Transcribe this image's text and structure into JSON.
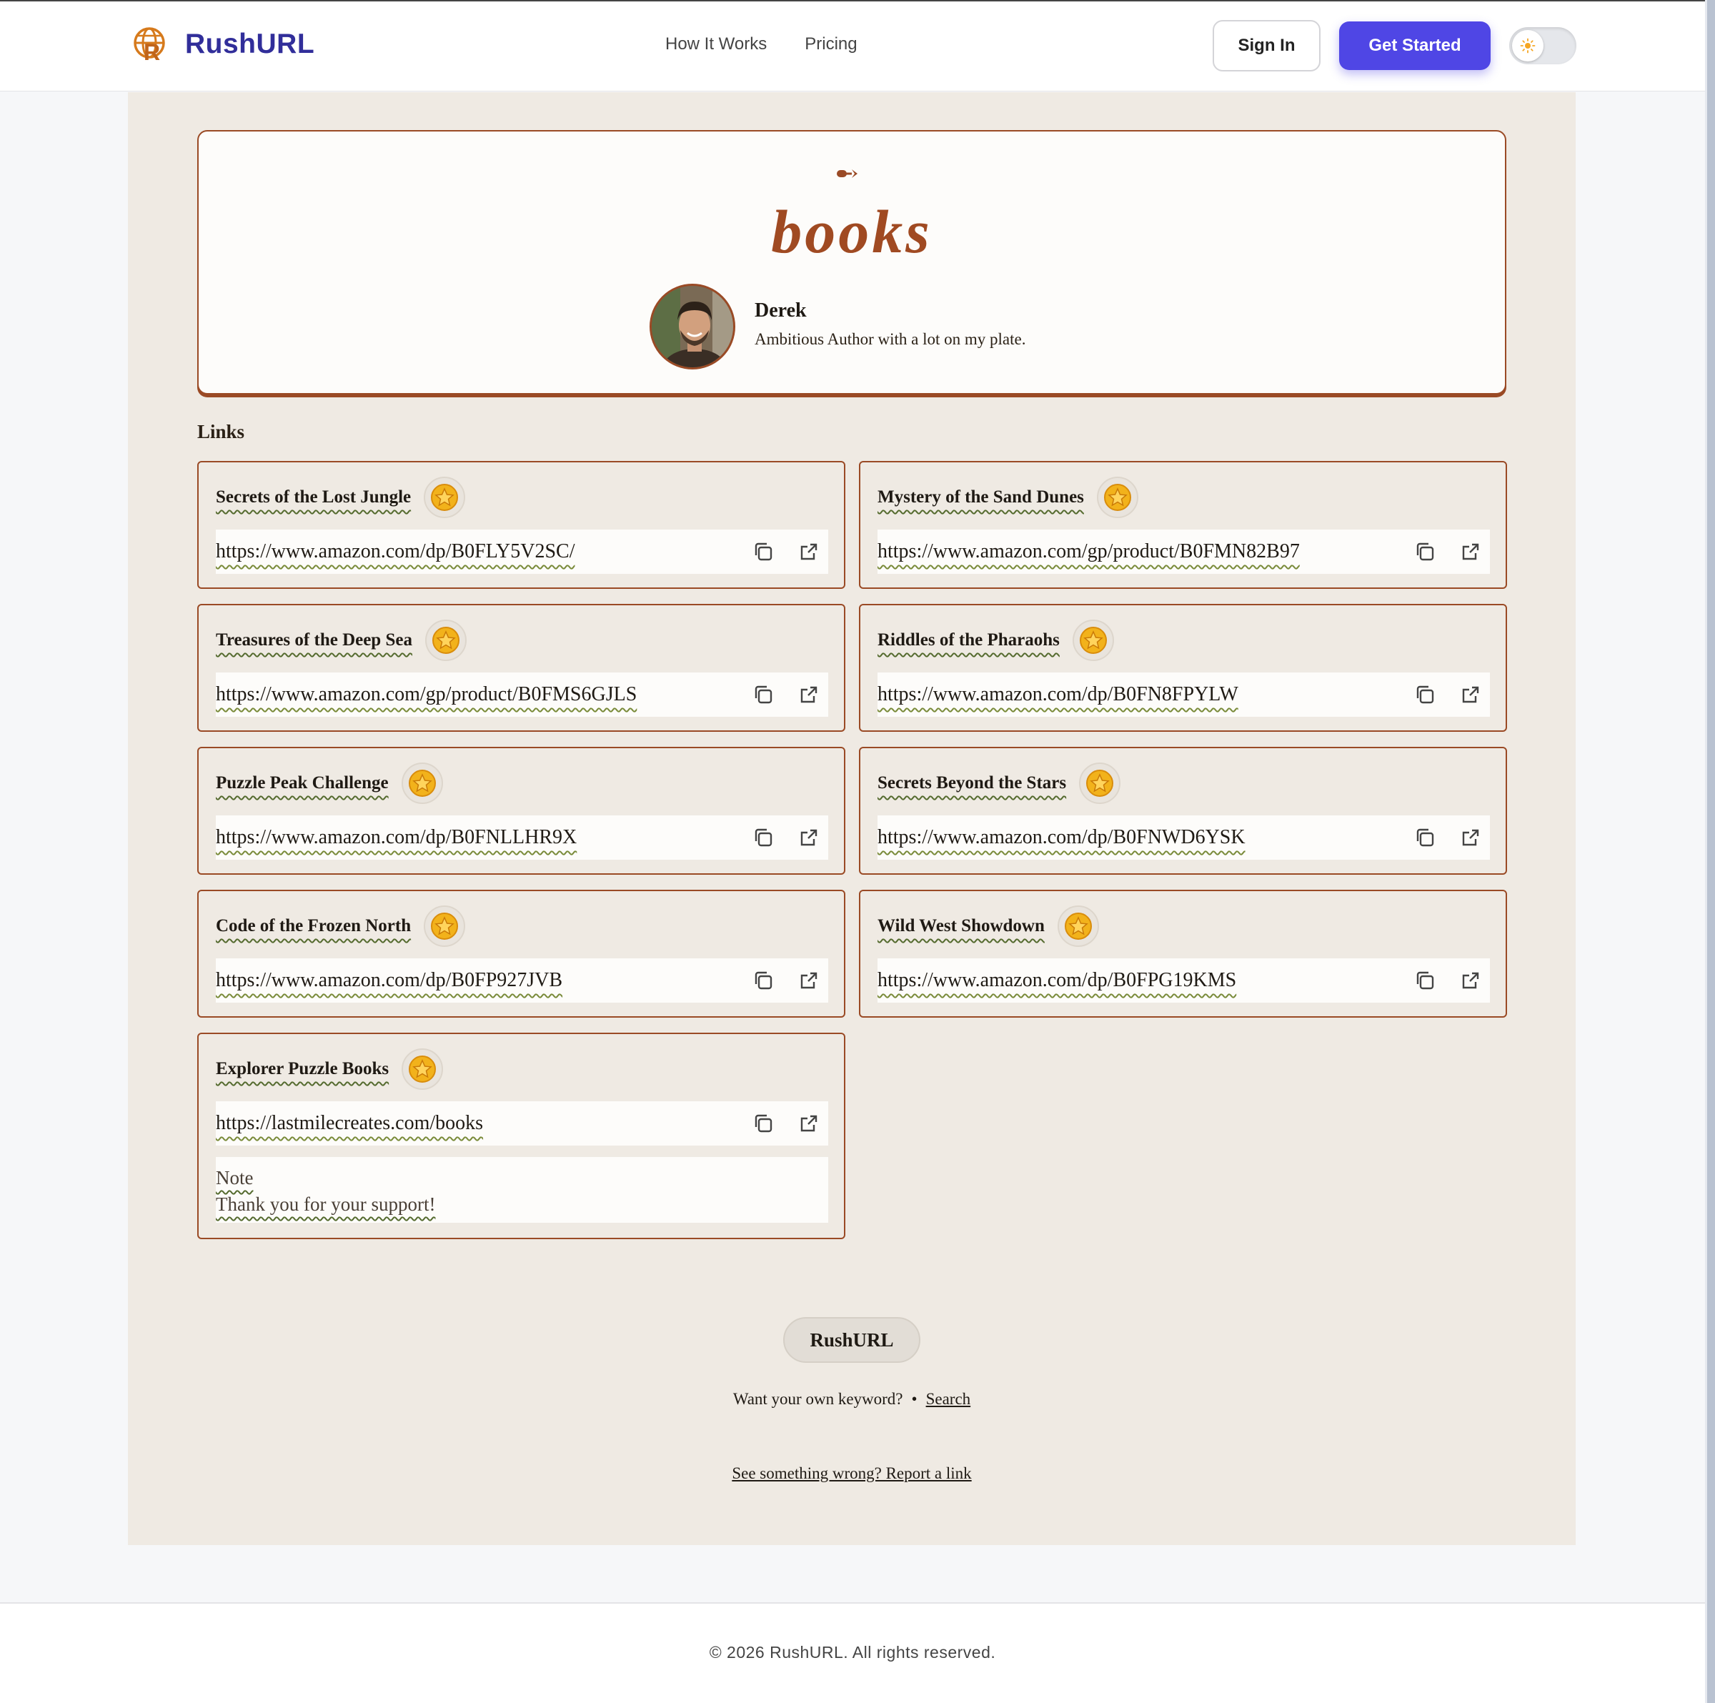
{
  "header": {
    "brand": "RushURL",
    "nav": [
      "How It Works",
      "Pricing"
    ],
    "sign_in": "Sign In",
    "get_started": "Get Started"
  },
  "colors": {
    "brand_indigo": "#4f46e5",
    "brand_text": "#312e9a",
    "accent_rust": "#9a4a25",
    "panel_bg": "#efeae3",
    "star_gold": "#f2b21b"
  },
  "profile": {
    "keyword": "books",
    "name": "Derek",
    "bio": "Ambitious Author with a lot on my plate."
  },
  "links_heading": "Links",
  "links": [
    {
      "title": "Secrets of the Lost Jungle",
      "url": "https://www.amazon.com/dp/B0FLY5V2SC/"
    },
    {
      "title": "Mystery of the Sand Dunes",
      "url": "https://www.amazon.com/gp/product/B0FMN82B97"
    },
    {
      "title": "Treasures of the Deep Sea",
      "url": "https://www.amazon.com/gp/product/B0FMS6GJLS"
    },
    {
      "title": "Riddles of the Pharaohs",
      "url": "https://www.amazon.com/dp/B0FN8FPYLW"
    },
    {
      "title": "Puzzle Peak Challenge",
      "url": "https://www.amazon.com/dp/B0FNLLHR9X"
    },
    {
      "title": "Secrets Beyond the Stars",
      "url": "https://www.amazon.com/dp/B0FNWD6YSK"
    },
    {
      "title": "Code of the Frozen North",
      "url": "https://www.amazon.com/dp/B0FP927JVB"
    },
    {
      "title": "Wild West Showdown",
      "url": "https://www.amazon.com/dp/B0FPG19KMS"
    },
    {
      "title": "Explorer Puzzle Books",
      "url": "https://lastmilecreates.com/books",
      "note_label": "Note",
      "note": "Thank you for your support!"
    }
  ],
  "icons": {
    "logo": "globe-r-logo-icon",
    "featured": "star-icon",
    "copy": "copy-icon",
    "open": "external-link-icon",
    "theme": "sun-icon",
    "profile": "pin-icon"
  },
  "footer": {
    "badge": "RushURL",
    "keyword_prompt": "Want your own keyword?",
    "separator": "•",
    "search": "Search",
    "report": "See something wrong? Report a link",
    "copyright": "© 2026 RushURL. All rights reserved."
  }
}
